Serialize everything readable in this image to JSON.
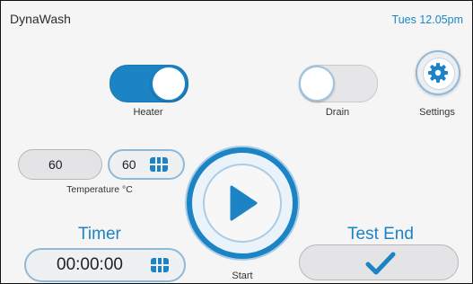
{
  "header": {
    "app_title": "DynaWash",
    "clock": "Tues 12.05pm"
  },
  "heater": {
    "label": "Heater",
    "state": "on"
  },
  "drain": {
    "label": "Drain",
    "state": "off"
  },
  "settings": {
    "label": "Settings",
    "icon": "gear-icon"
  },
  "temperature": {
    "current": "60",
    "setpoint": "60",
    "label": "Temperature °C"
  },
  "timer": {
    "title": "Timer",
    "value": "00:00:00"
  },
  "start": {
    "label": "Start",
    "icon": "play-icon"
  },
  "test_end": {
    "title": "Test End",
    "icon": "checkmark-icon"
  },
  "colors": {
    "accent": "#1c83c5",
    "background": "#f5f5f6"
  }
}
